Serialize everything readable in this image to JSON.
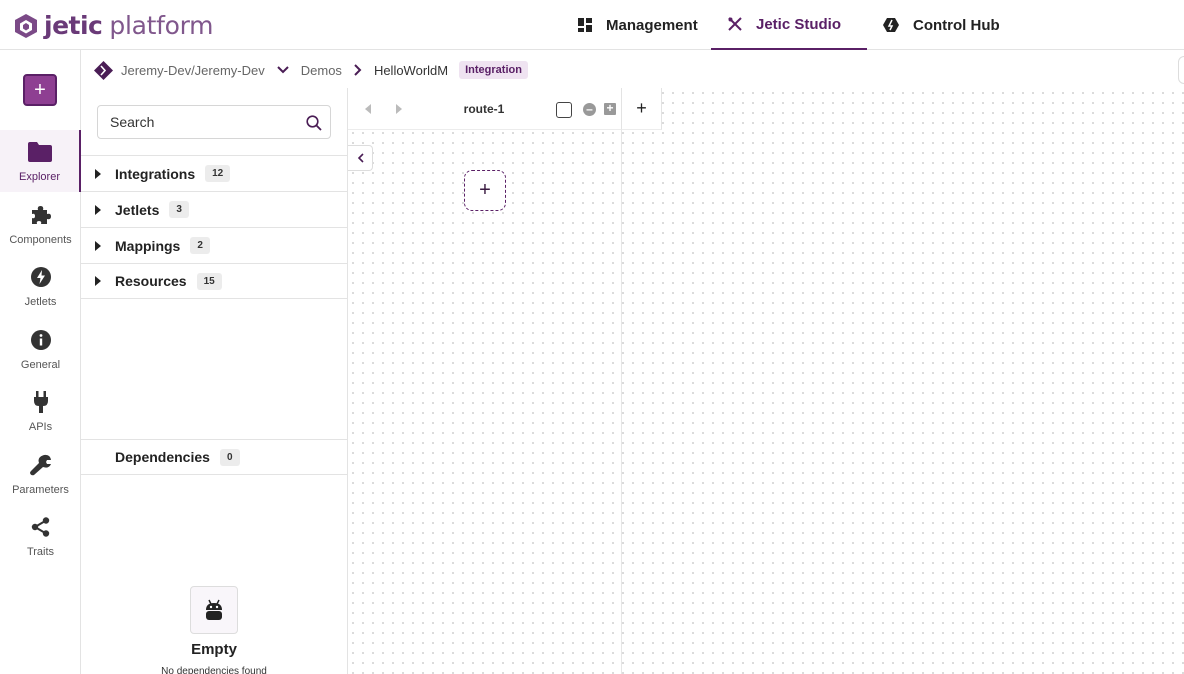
{
  "logo": {
    "brand": "jetic",
    "product": "platform"
  },
  "topnav": {
    "management": {
      "label": "Management",
      "icon": "dashboard-icon"
    },
    "studio": {
      "label": "Jetic Studio",
      "icon": "tools-icon"
    },
    "hub": {
      "label": "Control Hub",
      "icon": "hub-icon"
    }
  },
  "breadcrumb": {
    "repo": "Jeremy-Dev/Jeremy-Dev",
    "folder": "Demos",
    "current": "HelloWorldM",
    "badge": "Integration"
  },
  "rail": {
    "add_label": "+",
    "items": [
      {
        "label": "Explorer",
        "icon": "folder-icon",
        "active": true
      },
      {
        "label": "Components",
        "icon": "puzzle-icon"
      },
      {
        "label": "Jetlets",
        "icon": "bolt-icon"
      },
      {
        "label": "General",
        "icon": "info-icon"
      },
      {
        "label": "APIs",
        "icon": "plug-icon"
      },
      {
        "label": "Parameters",
        "icon": "wrench-icon"
      },
      {
        "label": "Traits",
        "icon": "share-icon"
      }
    ]
  },
  "explorer": {
    "search_placeholder": "Search",
    "sections": [
      {
        "label": "Integrations",
        "count": "12"
      },
      {
        "label": "Jetlets",
        "count": "3"
      },
      {
        "label": "Mappings",
        "count": "2"
      },
      {
        "label": "Resources",
        "count": "15"
      }
    ],
    "dependencies": {
      "label": "Dependencies",
      "count": "0"
    },
    "empty": {
      "title": "Empty",
      "subtitle": "No dependencies found"
    }
  },
  "canvas": {
    "route_name": "route-1",
    "add_route_label": "+",
    "add_step_label": "+"
  },
  "colors": {
    "accent": "#5a2066",
    "accent_light": "#8e3f92",
    "badge_bg": "#efe3f1"
  }
}
